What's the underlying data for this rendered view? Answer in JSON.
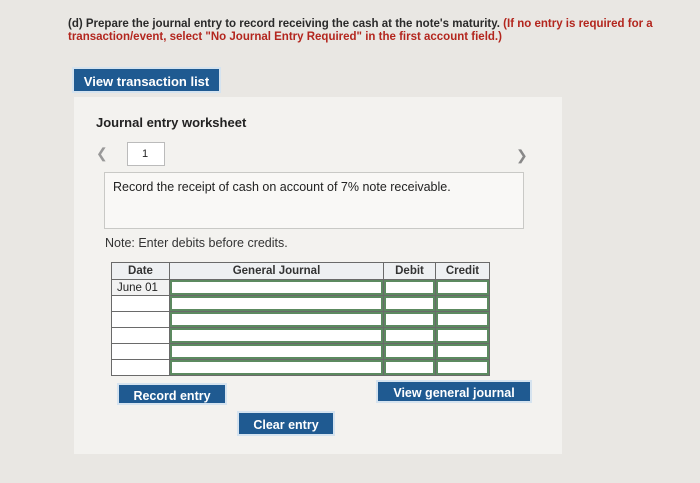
{
  "instructions": {
    "part": "(d) Prepare the journal entry to record receiving the cash at the note's maturity.",
    "note_red": "(If no entry is required for a transaction/event, select \"No Journal Entry Required\" in the first account field.)"
  },
  "view_transaction_list": "View transaction list",
  "worksheet": {
    "title": "Journal entry worksheet",
    "page": "1",
    "prev_icon": "chevron-left-icon",
    "next_icon": "chevron-right-icon",
    "description": "Record the receipt of cash on account of 7% note receivable.",
    "note": "Note: Enter debits before credits.",
    "table": {
      "headers": [
        "Date",
        "General Journal",
        "Debit",
        "Credit"
      ],
      "rows": [
        {
          "date": "June 01",
          "account": "",
          "debit": "",
          "credit": ""
        },
        {
          "date": "",
          "account": "",
          "debit": "",
          "credit": ""
        },
        {
          "date": "",
          "account": "",
          "debit": "",
          "credit": ""
        },
        {
          "date": "",
          "account": "",
          "debit": "",
          "credit": ""
        },
        {
          "date": "",
          "account": "",
          "debit": "",
          "credit": ""
        },
        {
          "date": "",
          "account": "",
          "debit": "",
          "credit": ""
        }
      ]
    },
    "record_entry": "Record entry",
    "clear_entry": "Clear entry",
    "view_general_journal": "View general journal"
  },
  "colors": {
    "button_blue": "#1f5a91",
    "instruction_red": "#b3261e",
    "page_bg": "#e9e7e3"
  }
}
